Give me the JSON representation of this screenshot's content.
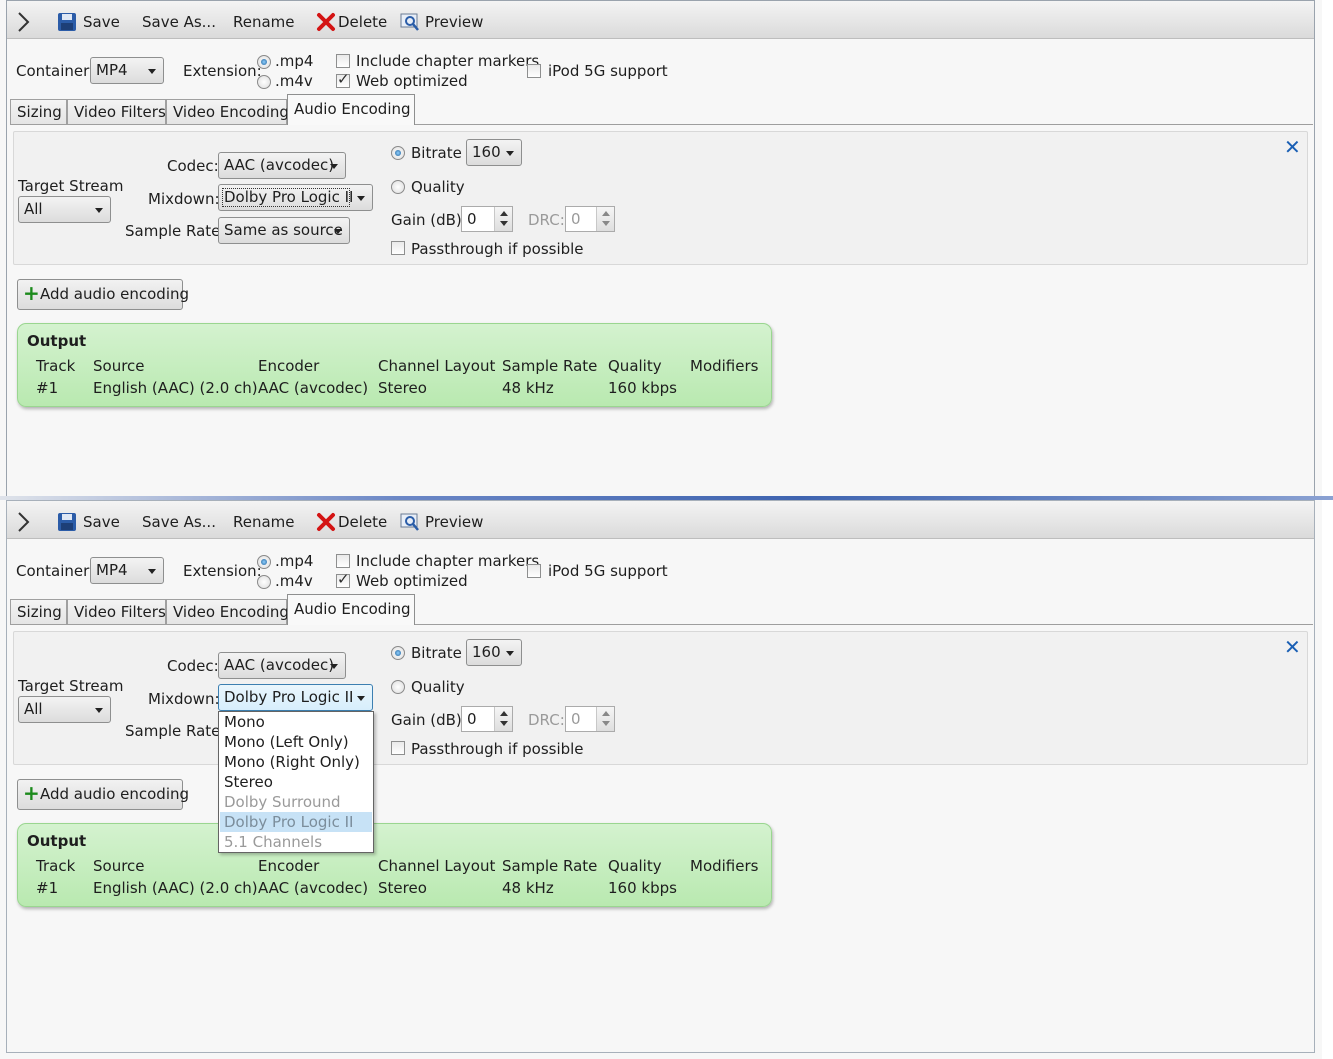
{
  "toolbar": {
    "save": "Save",
    "save_as": "Save As...",
    "rename": "Rename",
    "delete": "Delete",
    "preview": "Preview"
  },
  "settings": {
    "container_label": "Container:",
    "container_value": "MP4",
    "extension_label": "Extension:",
    "ext_mp4": ".mp4",
    "ext_m4v": ".m4v",
    "include_chapter_markers": "Include chapter markers",
    "web_optimized": "Web optimized",
    "ipod_support": "iPod 5G support"
  },
  "tabs": [
    "Sizing",
    "Video Filters",
    "Video Encoding",
    "Audio Encoding"
  ],
  "audio": {
    "target_stream_label": "Target Stream",
    "target_stream_value": "All",
    "codec_label": "Codec:",
    "codec_value": "AAC (avcodec)",
    "mixdown_label": "Mixdown:",
    "mixdown_value": "Dolby Pro Logic II",
    "sample_rate_label": "Sample Rate:",
    "sample_rate_value": "Same as source",
    "bitrate_label": "Bitrate",
    "bitrate_value": "160",
    "quality_label": "Quality",
    "gain_label": "Gain (dB):",
    "gain_value": "0",
    "drc_label": "DRC:",
    "drc_value": "0",
    "passthrough_label": "Passthrough if possible",
    "close_symbol": "✕"
  },
  "add_audio_encoding": "Add audio encoding",
  "output": {
    "title": "Output",
    "headers": [
      "Track",
      "Source",
      "Encoder",
      "Channel Layout",
      "Sample Rate",
      "Quality",
      "Modifiers"
    ],
    "row": [
      "#1",
      "English (AAC) (2.0 ch)",
      "AAC (avcodec)",
      "Stereo",
      "48 kHz",
      "160 kbps",
      ""
    ]
  },
  "mixdown_dropdown": {
    "options": [
      "Mono",
      "Mono (Left Only)",
      "Mono (Right Only)",
      "Stereo",
      "Dolby Surround",
      "Dolby Pro Logic II",
      "5.1 Channels"
    ],
    "disabled": [
      "Dolby Surround",
      "Dolby Pro Logic II",
      "5.1 Channels"
    ],
    "selected": "Dolby Pro Logic II"
  },
  "icons": {
    "save": "floppy-disk-icon",
    "delete": "red-x-icon",
    "preview": "magnifier-icon",
    "add": "green-plus-icon",
    "close": "blue-x-icon"
  },
  "colors": {
    "output_bg": "#c9eec2",
    "delete_red": "#d41414",
    "close_blue": "#1a5fb4",
    "selection_blue": "#c7e2f6"
  }
}
